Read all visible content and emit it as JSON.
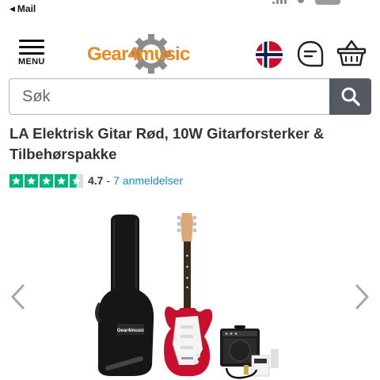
{
  "status_bar": {
    "back_label": "Mail",
    "back_icon": "back-triangle-icon"
  },
  "header": {
    "menu_label": "MENU",
    "logo_text": "Gear4music",
    "flag": "norway-flag",
    "icons": [
      "menu-icon",
      "chat-icon",
      "basket-icon"
    ]
  },
  "search": {
    "placeholder": "Søk",
    "button_icon": "search-icon"
  },
  "product": {
    "title": "LA Elektrisk Gitar Rød, 10W Gitarforsterker & Tilbehørspakke",
    "rating": {
      "stars": 4.5,
      "score": "4.7",
      "separator": "-",
      "reviews_link": "7 anmeldelser"
    },
    "gallery": {
      "bag_logo": "Gear4music"
    }
  },
  "colors": {
    "brand_orange": "#f08a1c",
    "brand_grey": "#8c8c8c",
    "trustpilot_green": "#00b67a",
    "link_blue": "#1f8cc1",
    "search_button": "#555a60",
    "guitar_red": "#c8102e"
  }
}
